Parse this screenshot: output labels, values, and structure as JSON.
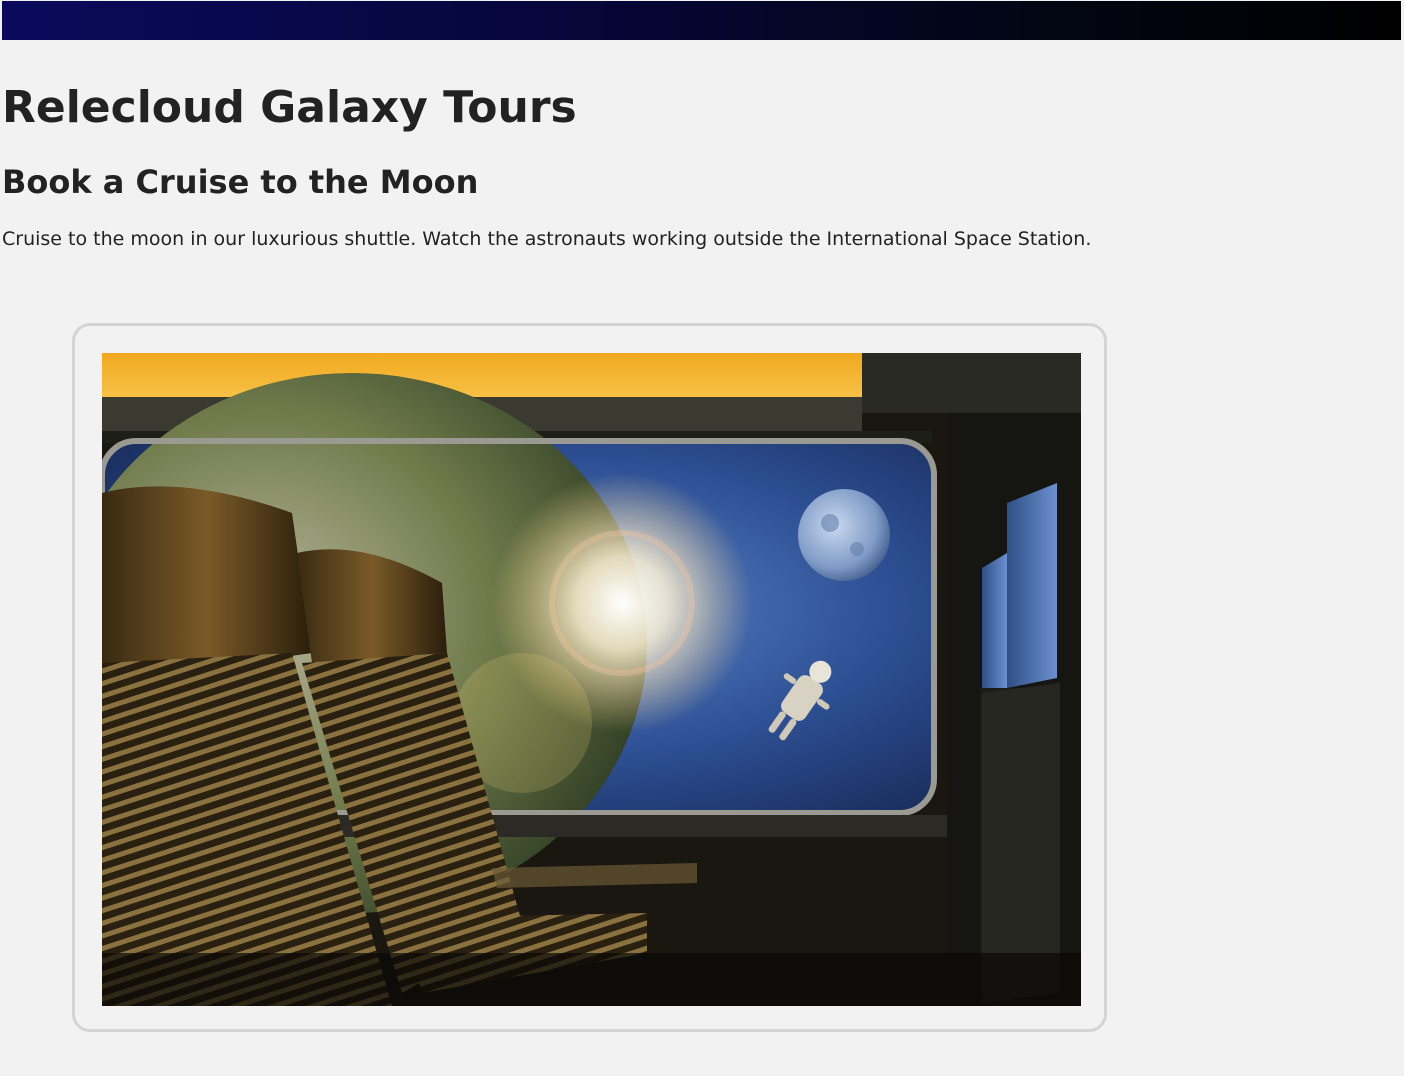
{
  "header": {
    "site_title": "Relecloud Galaxy Tours"
  },
  "main": {
    "heading": "Book a Cruise to the Moon",
    "description": "Cruise to the moon in our luxurious shuttle. Watch the astronauts working outside the International Space Station."
  },
  "colors": {
    "topbar_start": "#0a0a5c",
    "topbar_end": "#000000",
    "page_background": "#f2f2f2",
    "text": "#222222",
    "frame_border": "#d4d4d4"
  }
}
